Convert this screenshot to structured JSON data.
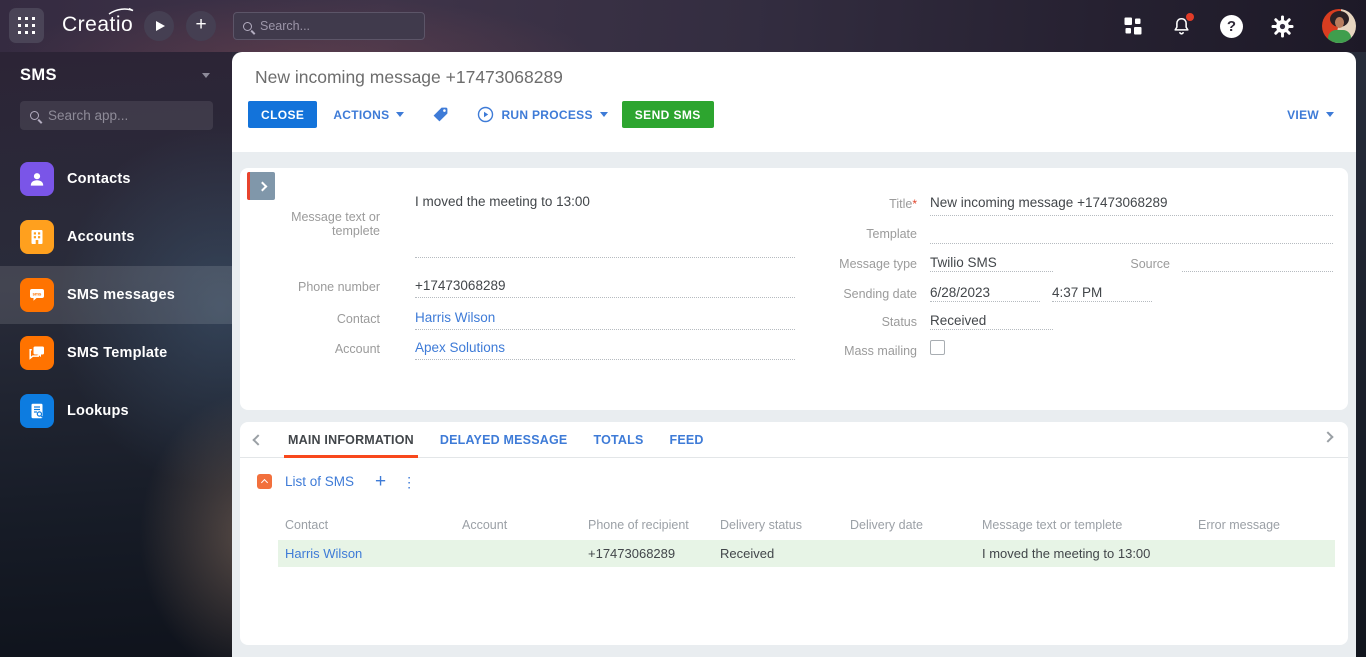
{
  "colors": {
    "primary_button": "#1373da",
    "send_button": "#2da52f",
    "link": "#3e7bd7",
    "tab_active_underline": "#f8481c",
    "selected_row_bg": "#e7f4e6",
    "required_asterisk": "#e0452c"
  },
  "topbar": {
    "logo": "Creatio",
    "search": {
      "placeholder": "Search..."
    }
  },
  "sidebar": {
    "workspace_title": "SMS",
    "app_search_placeholder": "Search app...",
    "items": [
      {
        "label": "Contacts",
        "selected": false
      },
      {
        "label": "Accounts",
        "selected": false
      },
      {
        "label": "SMS messages",
        "selected": true
      },
      {
        "label": "SMS Template",
        "selected": false
      },
      {
        "label": "Lookups",
        "selected": false
      }
    ]
  },
  "page": {
    "title": "New incoming message +17473068289",
    "toolbar": {
      "close": "CLOSE",
      "actions": "ACTIONS",
      "run_process": "RUN PROCESS",
      "send_sms": "SEND SMS",
      "view": "VIEW"
    }
  },
  "form": {
    "message_text": {
      "label": "Message text or templete",
      "value": "I moved the meeting to 13:00"
    },
    "phone_number": {
      "label": "Phone number",
      "value": "+17473068289"
    },
    "contact": {
      "label": "Contact",
      "value": "Harris Wilson"
    },
    "account": {
      "label": "Account",
      "value": "Apex Solutions"
    },
    "title": {
      "label": "Title",
      "required_mark": "*",
      "value": "New incoming message +17473068289"
    },
    "template": {
      "label": "Template",
      "value": ""
    },
    "message_type": {
      "label": "Message type",
      "value": "Twilio SMS"
    },
    "source": {
      "label": "Source",
      "value": ""
    },
    "sending_date": {
      "label": "Sending date",
      "date": "6/28/2023",
      "time": "4:37 PM"
    },
    "status": {
      "label": "Status",
      "value": "Received"
    },
    "mass_mailing": {
      "label": "Mass mailing",
      "checked": false
    }
  },
  "tabs": {
    "items": [
      {
        "label": "MAIN INFORMATION",
        "active": true
      },
      {
        "label": "DELAYED MESSAGE",
        "active": false
      },
      {
        "label": "TOTALS",
        "active": false
      },
      {
        "label": "FEED",
        "active": false
      }
    ]
  },
  "sms_list": {
    "title": "List of SMS",
    "columns": [
      "Contact",
      "Account",
      "Phone of recipient",
      "Delivery status",
      "Delivery date",
      "Message text or templete",
      "Error message"
    ],
    "rows": [
      {
        "contact": "Harris Wilson",
        "account": "",
        "phone": "+17473068289",
        "delivery_status": "Received",
        "delivery_date": "",
        "message": "I moved the meeting to 13:00",
        "error": ""
      }
    ]
  }
}
